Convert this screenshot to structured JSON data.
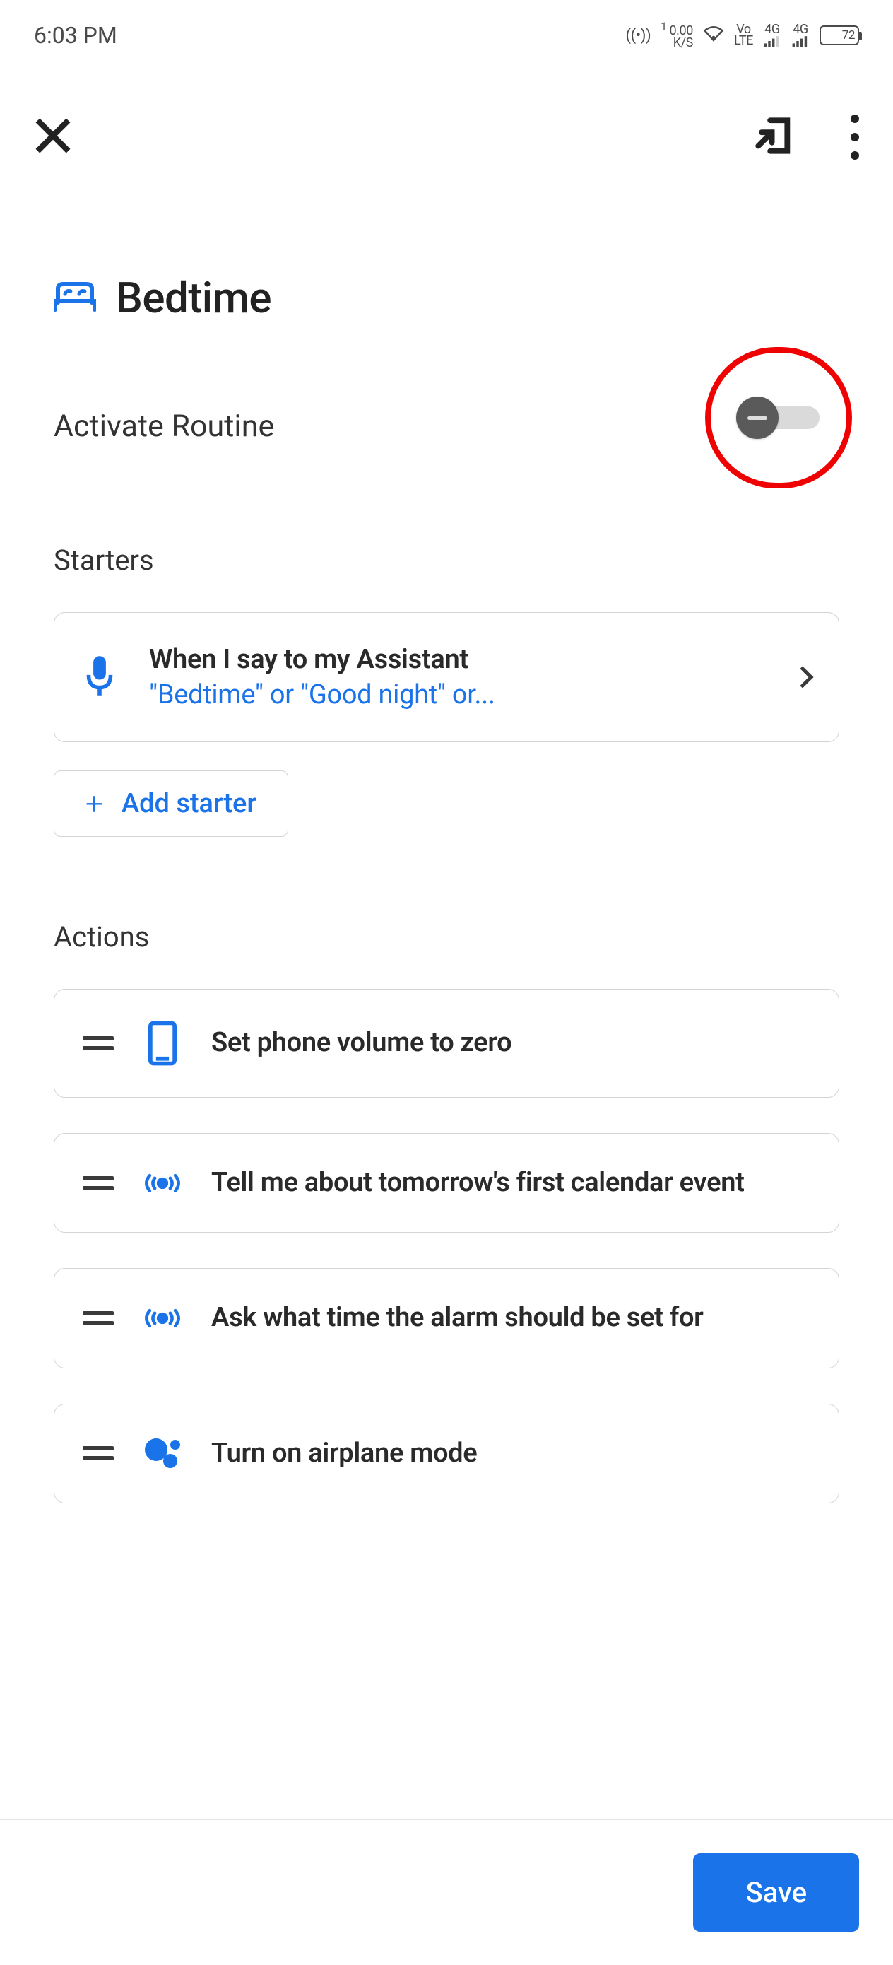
{
  "status": {
    "time": "6:03 PM",
    "kps_top": "0.00",
    "kps_bottom": "K/S",
    "kps_badge": "1",
    "volte_top": "Vo",
    "volte_bottom": "LTE",
    "signal1": "4G",
    "signal2": "4G",
    "battery": "72"
  },
  "page": {
    "title": "Bedtime",
    "activate_label": "Activate Routine"
  },
  "sections": {
    "starters": "Starters",
    "actions": "Actions"
  },
  "starter": {
    "title": "When I say to my Assistant",
    "subtitle": "\"Bedtime\" or \"Good night\" or..."
  },
  "add_starter": "Add starter",
  "actions": [
    {
      "icon": "phone",
      "label": "Set phone volume to zero"
    },
    {
      "icon": "broadcast",
      "label": "Tell me about tomorrow's first calendar event"
    },
    {
      "icon": "broadcast",
      "label": "Ask what time the alarm should be set for"
    },
    {
      "icon": "assistant",
      "label": "Turn on airplane mode"
    }
  ],
  "footer": {
    "save": "Save"
  }
}
